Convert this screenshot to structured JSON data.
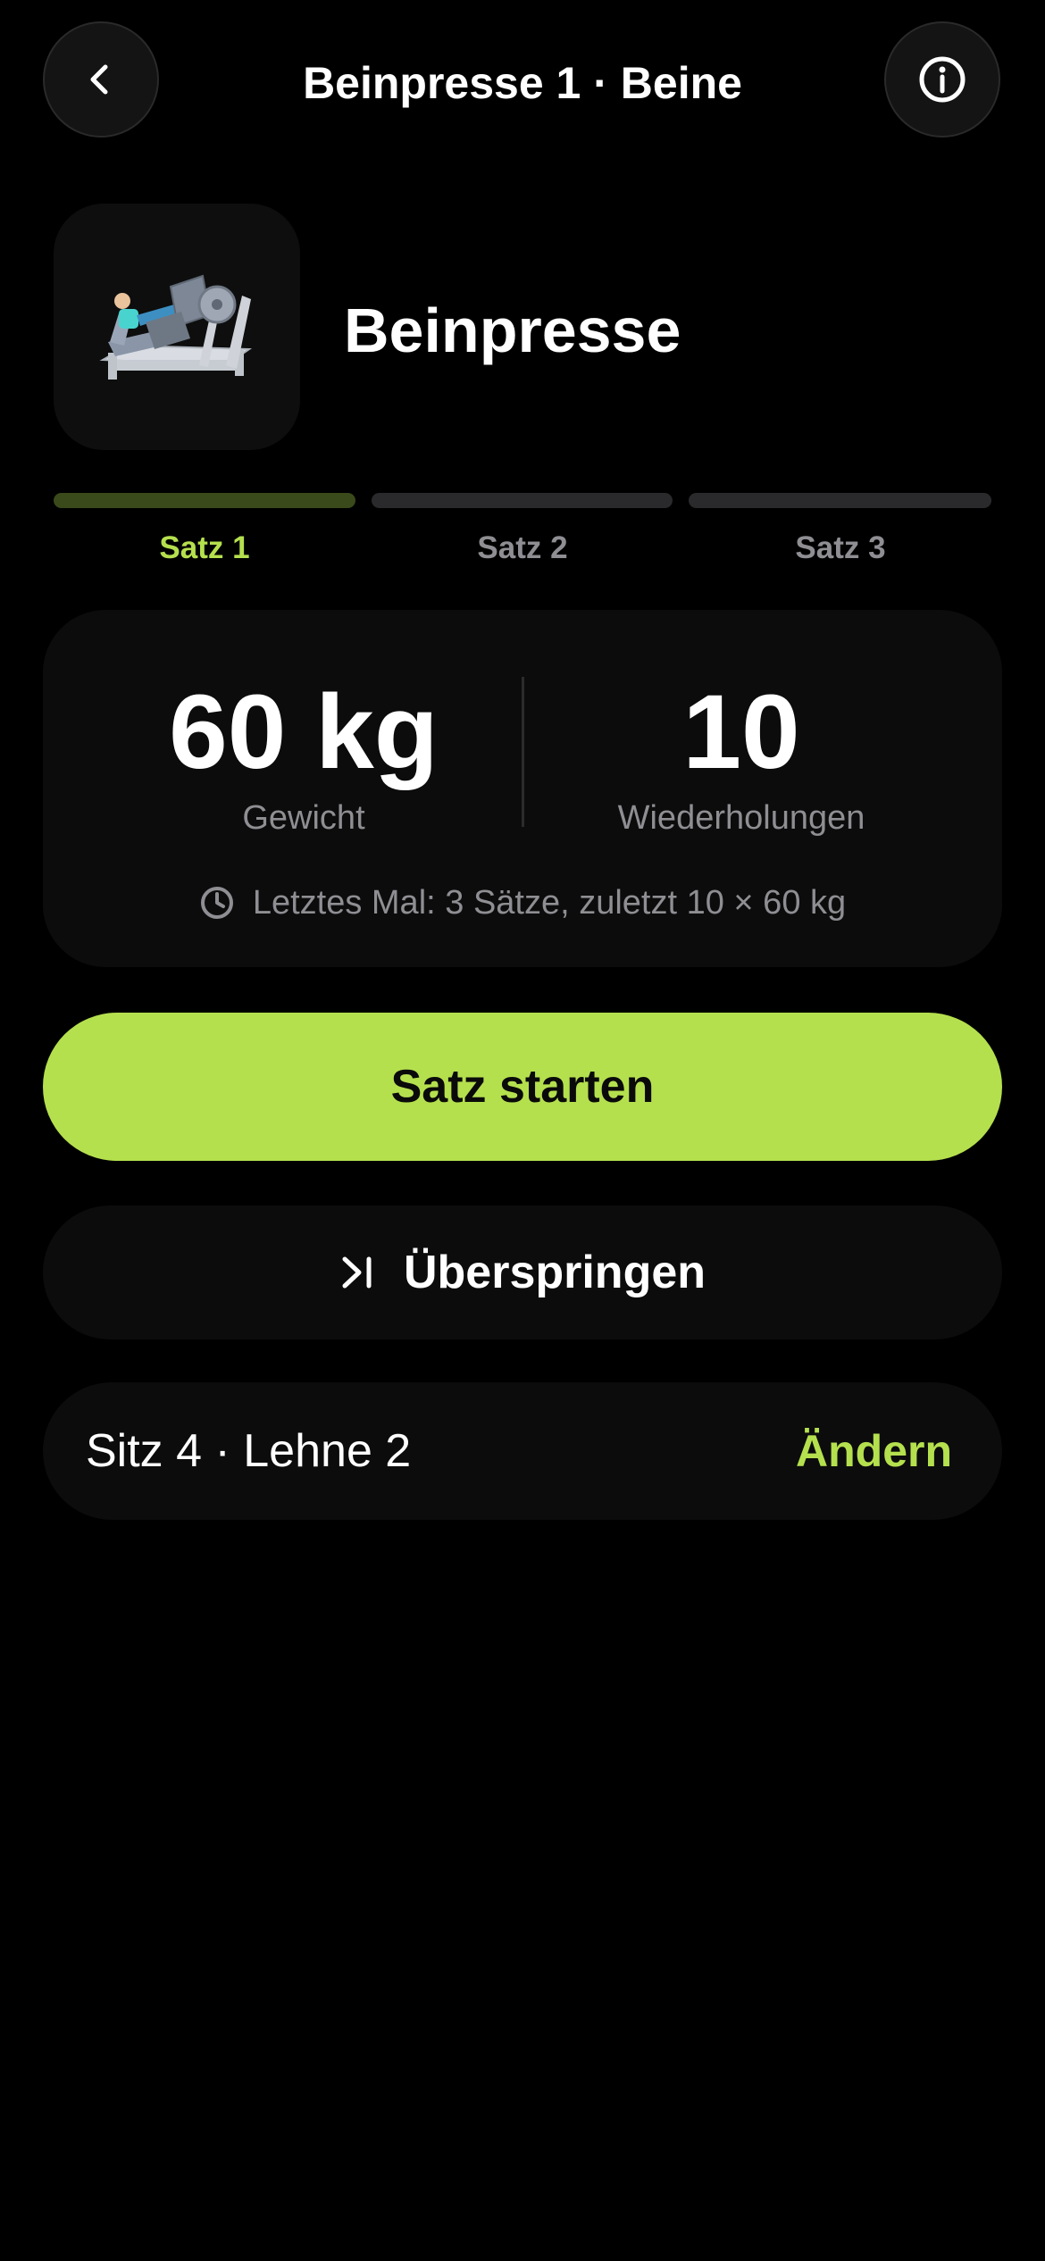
{
  "header": {
    "title": "Beinpresse 1 · Beine",
    "back_icon": "chevron-left-icon",
    "info_icon": "info-circle-icon"
  },
  "machine": {
    "name": "Beinpresse",
    "image_icon": "leg-press-machine-icon"
  },
  "sets": {
    "items": [
      {
        "label": "Satz 1",
        "active": true
      },
      {
        "label": "Satz 2",
        "active": false
      },
      {
        "label": "Satz 3",
        "active": false
      }
    ]
  },
  "stats": {
    "weight_value": "60 kg",
    "weight_label": "Gewicht",
    "reps_value": "10",
    "reps_label": "Wiederholungen",
    "last_time": "Letztes Mal: 3 Sätze, zuletzt 10 × 60 kg"
  },
  "actions": {
    "start_label": "Satz starten",
    "skip_label": "Überspringen"
  },
  "settings": {
    "text": "Sitz 4 · Lehne 2",
    "change_label": "Ändern"
  },
  "colors": {
    "accent": "#b5e04e",
    "background": "#000000",
    "card": "#0c0c0c",
    "muted_text": "#8e8e93"
  }
}
